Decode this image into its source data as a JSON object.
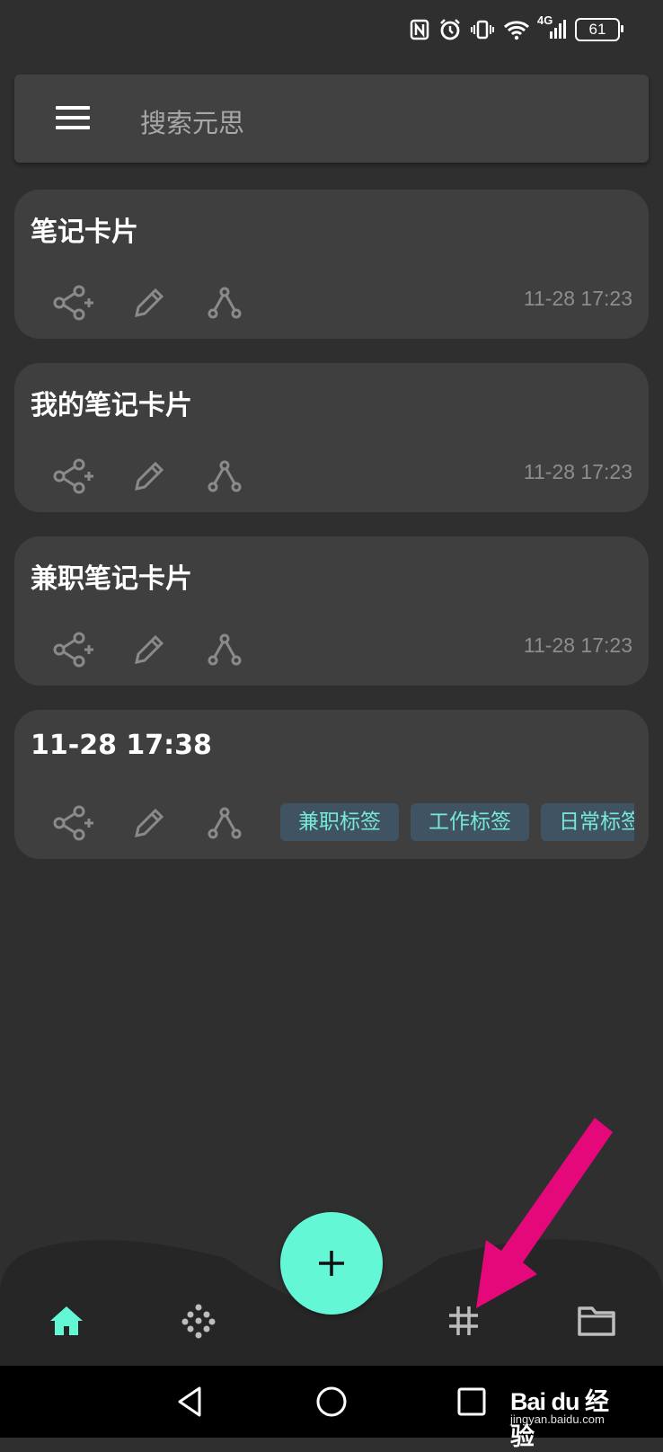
{
  "status_bar": {
    "network": "4G",
    "battery": "61"
  },
  "search": {
    "placeholder": "搜索元思"
  },
  "cards": [
    {
      "title": "笔记卡片",
      "time": "11-28 17:23"
    },
    {
      "title": "我的笔记卡片",
      "time": "11-28 17:23"
    },
    {
      "title": "兼职笔记卡片",
      "time": "11-28 17:23"
    },
    {
      "title": "11-28 17:38",
      "tags": [
        "兼职标签",
        "工作标签",
        "日常标签"
      ]
    }
  ],
  "colors": {
    "accent": "#64f7d6",
    "tag_text": "#77e9db",
    "tag_bg": "#3f5362",
    "annotation_arrow": "#e4087a"
  },
  "icons": {
    "nav": [
      "home-icon",
      "dots-grid-icon",
      "hashtag-icon",
      "folder-icon"
    ],
    "card_actions": [
      "share-add-icon",
      "edit-pencil-icon",
      "graph-link-icon"
    ]
  },
  "watermark": {
    "logo": "Bai du 经验",
    "sub": "jingyan.baidu.com"
  }
}
